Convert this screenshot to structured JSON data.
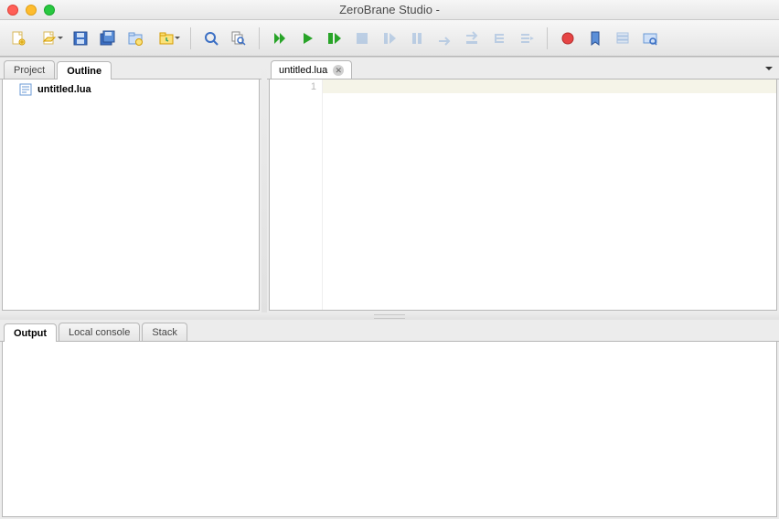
{
  "window": {
    "title": "ZeroBrane Studio -"
  },
  "toolbar": {
    "new": "New",
    "open": "Open",
    "save": "Save",
    "saveall": "Save All",
    "projdir": "Project Folder",
    "find": "Find",
    "findfiles": "Find in Files",
    "replace": "Replace",
    "rundbg": "Start Debugging",
    "run": "Run",
    "rundetached": "Run Detached",
    "stop": "Stop",
    "step": "Step Into",
    "stepover": "Step Over",
    "stepout": "Step Out",
    "break": "Break",
    "breakpoint": "Toggle Breakpoint",
    "bookmark": "Toggle Bookmark",
    "stack": "Stack",
    "watch": "Watch"
  },
  "side": {
    "tabs": {
      "project": "Project",
      "outline": "Outline"
    },
    "active": "outline",
    "outline_item": "untitled.lua"
  },
  "editor": {
    "tab_label": "untitled.lua",
    "line_numbers": [
      "1"
    ],
    "lines": [
      ""
    ]
  },
  "bottom": {
    "tabs": {
      "output": "Output",
      "console": "Local console",
      "stack": "Stack"
    },
    "active": "output"
  }
}
